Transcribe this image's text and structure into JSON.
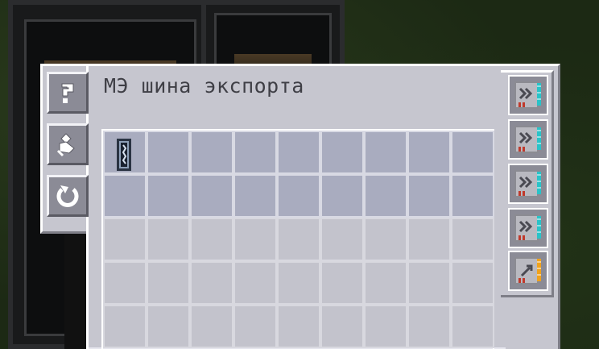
{
  "window": {
    "title": "МЭ шина экспорта"
  },
  "side_tools": [
    {
      "name": "help",
      "icon": "question-mark-icon"
    },
    {
      "name": "fuzzy-mode",
      "icon": "brush-icon"
    },
    {
      "name": "redstone-mode",
      "icon": "refresh-icon"
    }
  ],
  "filter_grid": {
    "columns": 9,
    "active_rows": 2,
    "total_rows": 5,
    "items": [
      {
        "slot": 0,
        "icon": "capacity-card-icon"
      }
    ]
  },
  "upgrade_slots": [
    {
      "icon": "acceleration-card-icon",
      "accent": "#29c3c8"
    },
    {
      "icon": "acceleration-card-icon",
      "accent": "#29c3c8"
    },
    {
      "icon": "acceleration-card-icon",
      "accent": "#29c3c8"
    },
    {
      "icon": "acceleration-card-icon",
      "accent": "#29c3c8"
    },
    {
      "icon": "crafting-card-icon",
      "accent": "#f0a21c"
    }
  ],
  "colors": {
    "panel": "#c6c6cf",
    "active_slot": "#a9acbf",
    "inactive_slot": "#c3c3cc",
    "title_text": "#3f3f46"
  }
}
